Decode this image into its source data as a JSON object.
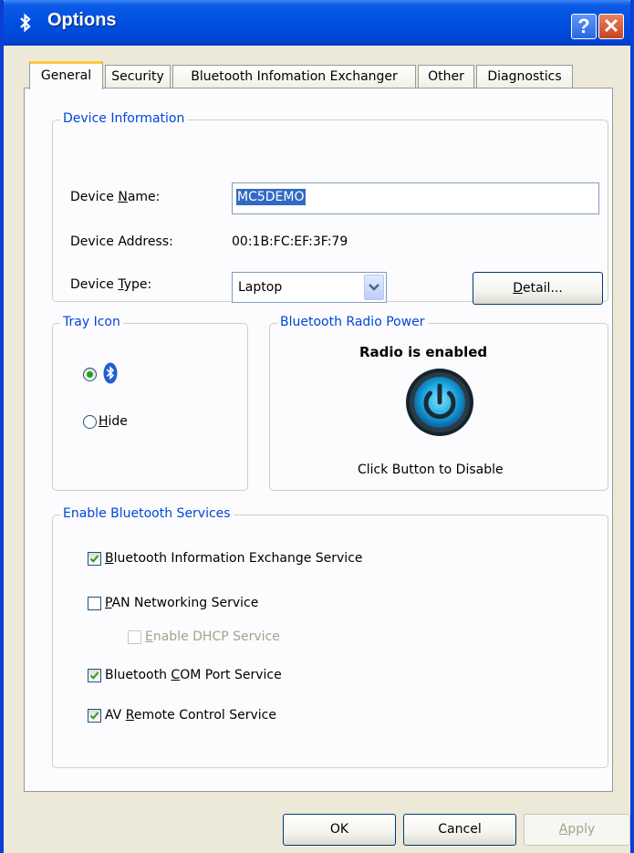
{
  "window": {
    "title": "Options",
    "help_glyph": "?",
    "close_glyph": "✕"
  },
  "tabs": [
    {
      "label": "General",
      "active": true
    },
    {
      "label": "Security"
    },
    {
      "label": "Bluetooth Infomation Exchanger"
    },
    {
      "label": "Other"
    },
    {
      "label": "Diagnostics"
    }
  ],
  "device_info": {
    "legend": "Device Information",
    "name_label_pre": "Device ",
    "name_label_mn": "N",
    "name_label_post": "ame:",
    "name_value": "MC5DEMO",
    "address_label": "Device Address:",
    "address_value": "00:1B:FC:EF:3F:79",
    "type_label_pre": "Device ",
    "type_label_mn": "T",
    "type_label_post": "ype:",
    "type_value": "Laptop",
    "detail_mn": "D",
    "detail_rest": "etail..."
  },
  "tray_icon": {
    "legend": "Tray Icon",
    "hide_mn": "H",
    "hide_rest": "ide",
    "selected_option": "show"
  },
  "radio_power": {
    "legend": "Bluetooth Radio Power",
    "status": "Radio is enabled",
    "hint": "Click Button to Disable"
  },
  "services": {
    "legend": "Enable Bluetooth Services",
    "items": [
      {
        "pre": "",
        "mn": "B",
        "post": "luetooth Information Exchange Service",
        "checked": true,
        "enabled": true
      },
      {
        "pre": "",
        "mn": "P",
        "post": "AN Networking Service",
        "checked": false,
        "enabled": true
      },
      {
        "pre": "",
        "mn": "E",
        "post": "nable DHCP Service",
        "checked": false,
        "enabled": false
      },
      {
        "pre": "Bluetooth ",
        "mn": "C",
        "post": "OM Port Service",
        "checked": true,
        "enabled": true
      },
      {
        "pre": "AV ",
        "mn": "R",
        "post": "emote Control Service",
        "checked": true,
        "enabled": true
      }
    ]
  },
  "buttons": {
    "ok": "OK",
    "cancel": "Cancel",
    "apply_mn": "A",
    "apply_rest": "pply"
  },
  "colors": {
    "titlebar": "#0050e0",
    "legend_text": "#0046d5",
    "check_green": "#21a121",
    "power_glow": "#2ac4f0"
  }
}
